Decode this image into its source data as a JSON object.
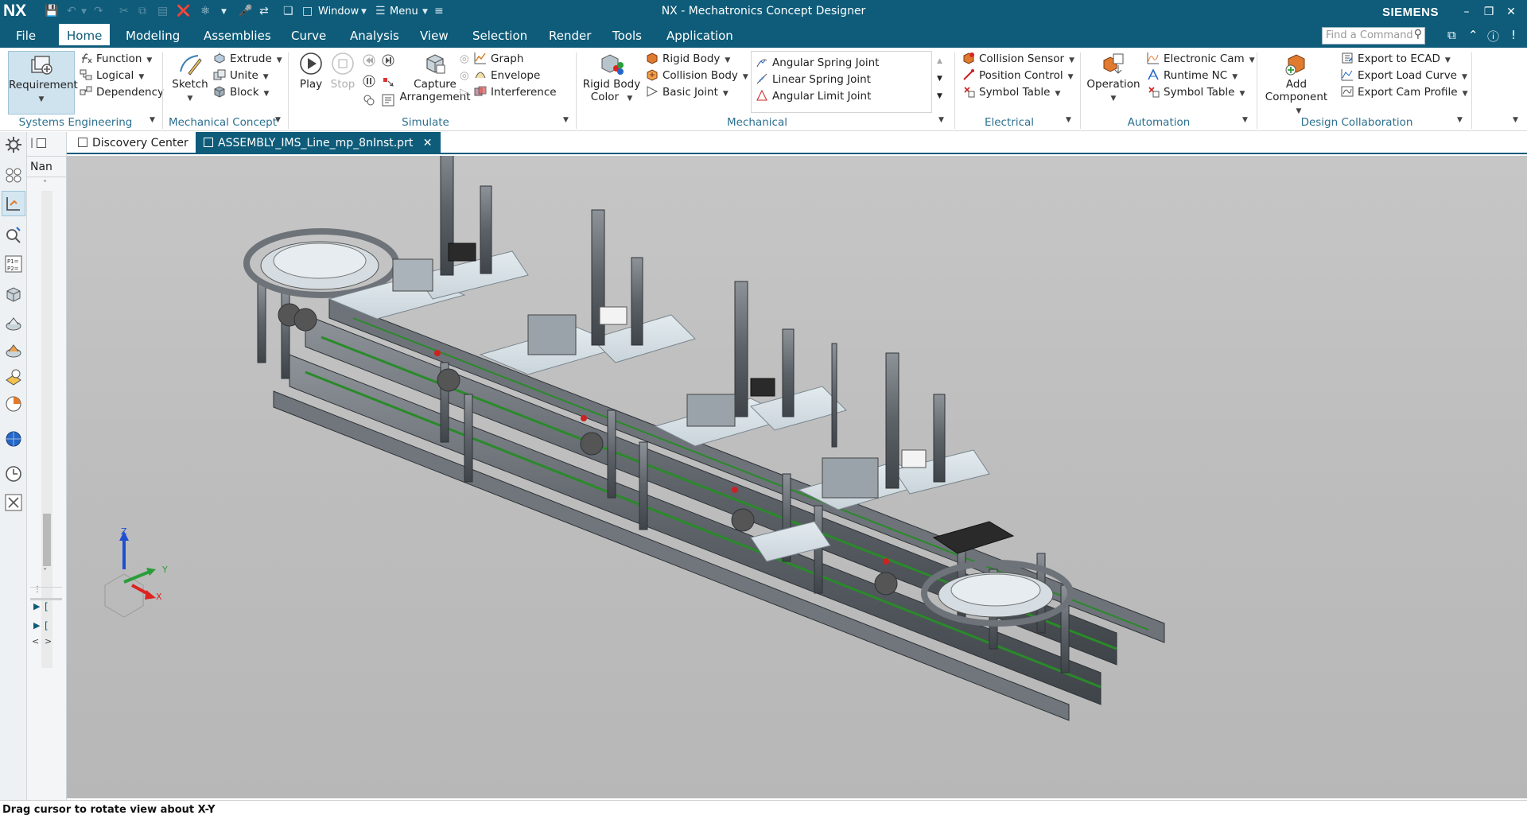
{
  "app": {
    "logo": "NX",
    "title": "NX - Mechatronics Concept Designer",
    "brand": "SIEMENS",
    "quick_access": {
      "window_label": "Window",
      "menu_label": "Menu"
    }
  },
  "menu_tabs": [
    "File",
    "Home",
    "Modeling",
    "Assemblies",
    "Curve",
    "Analysis",
    "View",
    "Selection",
    "Render",
    "Tools",
    "Application"
  ],
  "active_tab": "Home",
  "search": {
    "placeholder": "Find a Command"
  },
  "ribbon": {
    "groups": {
      "systems_engineering": {
        "label": "Systems Engineering",
        "big": "Requirement",
        "items": [
          "Function",
          "Logical",
          "Dependency"
        ]
      },
      "mechanical_concept": {
        "label": "Mechanical Concept",
        "big": "Sketch",
        "items": [
          "Extrude",
          "Unite",
          "Block"
        ]
      },
      "simulate": {
        "label": "Simulate",
        "play": "Play",
        "stop": "Stop",
        "capture": "Capture Arrangement",
        "items": [
          "Graph",
          "Envelope",
          "Interference"
        ]
      },
      "mechanical": {
        "label": "Mechanical",
        "big": "Rigid Body Color",
        "items": [
          "Rigid Body",
          "Collision Body",
          "Basic Joint"
        ],
        "joints": [
          "Angular Spring Joint",
          "Linear Spring Joint",
          "Angular Limit Joint"
        ]
      },
      "electrical": {
        "label": "Electrical",
        "items": [
          "Collision Sensor",
          "Position Control",
          "Symbol Table"
        ]
      },
      "automation": {
        "label": "Automation",
        "big": "Operation",
        "items": [
          "Electronic Cam",
          "Runtime NC",
          "Symbol Table"
        ]
      },
      "design_collaboration": {
        "label": "Design Collaboration",
        "big": "Add Component",
        "items": [
          "Export to ECAD",
          "Export Load Curve",
          "Export Cam Profile"
        ]
      }
    }
  },
  "doc_tabs": [
    "Discovery Center",
    "ASSEMBLY_IMS_Line_mp_8nInst.prt"
  ],
  "nav_pane": {
    "column_header": "Nan"
  },
  "triad": {
    "x": "X",
    "y": "Y",
    "z": "Z"
  },
  "status": "Drag cursor to rotate view about X-Y",
  "colors": {
    "brand": "#0e5c7a",
    "group_label": "#2b6f8f",
    "viewport": "#bdbdbd"
  }
}
